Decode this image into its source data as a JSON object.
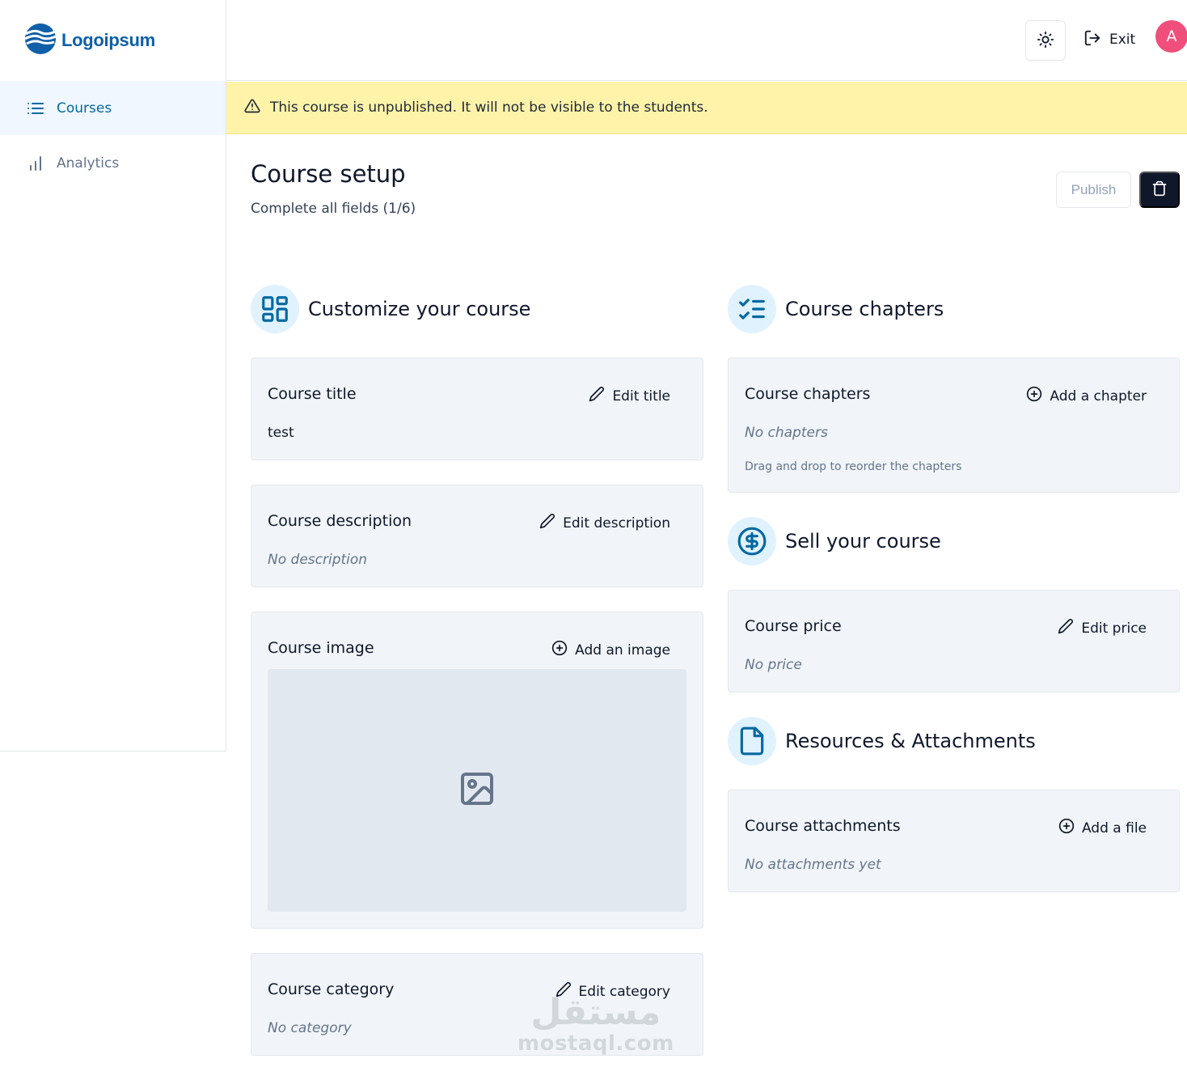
{
  "brand": {
    "name": "Logoipsum"
  },
  "sidebar": {
    "items": [
      {
        "label": "Courses",
        "icon": "list-icon",
        "active": true
      },
      {
        "label": "Analytics",
        "icon": "bar-chart-icon",
        "active": false
      }
    ]
  },
  "topbar": {
    "theme_icon": "sun-icon",
    "exit_label": "Exit",
    "avatar_initial": "A",
    "avatar_color": "#ef4f7a"
  },
  "banner": {
    "text": "This course is unpublished. It will not be visible to the students.",
    "color": "#fef3a8"
  },
  "header": {
    "title": "Course setup",
    "subtitle": "Complete all fields (1/6)",
    "publish_label": "Publish"
  },
  "sections": {
    "customize": {
      "title": "Customize your course",
      "icon": "layout-dashboard-icon"
    },
    "chapters": {
      "title": "Course chapters",
      "icon": "list-checks-icon"
    },
    "sell": {
      "title": "Sell your course",
      "icon": "circle-dollar-icon"
    },
    "resources": {
      "title": "Resources & Attachments",
      "icon": "file-icon"
    }
  },
  "cards": {
    "title": {
      "label": "Course title",
      "action": "Edit title",
      "value": "test"
    },
    "description": {
      "label": "Course description",
      "action": "Edit description",
      "value": "No description"
    },
    "image": {
      "label": "Course image",
      "action": "Add an image"
    },
    "category": {
      "label": "Course category",
      "action": "Edit category",
      "value": "No category"
    },
    "chapters": {
      "label": "Course chapters",
      "action": "Add a chapter",
      "value": "No chapters",
      "hint": "Drag and drop to reorder the chapters"
    },
    "price": {
      "label": "Course price",
      "action": "Edit price",
      "value": "No price"
    },
    "attachments": {
      "label": "Course attachments",
      "action": "Add a file",
      "value": "No attachments yet"
    }
  },
  "watermark": {
    "arabic": "مستقل",
    "latin": "mostaql.com"
  },
  "colors": {
    "accent": "#0369a1",
    "dark": "#0f172a",
    "card_bg": "#f1f5f9",
    "icon_bg": "#e0f2fe"
  }
}
